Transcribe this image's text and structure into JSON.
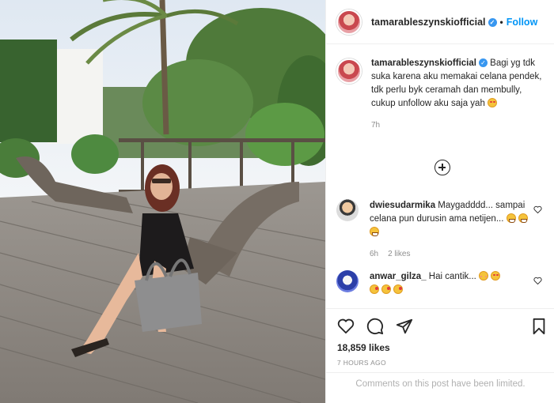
{
  "header": {
    "username": "tamarableszynskiofficial",
    "dot": "•",
    "follow_label": "Follow"
  },
  "caption": {
    "username": "tamarableszynskiofficial",
    "text": "Bagi yg tdk suka karena aku memakai celana pendek, tdk perlu byk ceramah dan membully, cukup unfollow aku saja yah",
    "time": "7h"
  },
  "comments": [
    {
      "username": "dwiesudarmika",
      "text": "Maygadddd... sampai celana pun durusin ama netijen...",
      "time": "6h",
      "likes": "2 likes"
    },
    {
      "username": "anwar_gilza_",
      "text": "Hai cantik..."
    }
  ],
  "actions": {
    "likes": "18,859 likes",
    "time_ago": "7 HOURS AGO",
    "limited_notice": "Comments on this post have been limited."
  },
  "icons": {
    "verified": "verified-badge-icon",
    "add": "plus-circle-icon",
    "like": "heart-icon",
    "comment": "comment-icon",
    "share": "paper-plane-icon",
    "save": "bookmark-icon"
  },
  "colors": {
    "accent": "#0095f6",
    "text": "#262626",
    "muted": "#8e8e8e",
    "border": "#efefef"
  }
}
